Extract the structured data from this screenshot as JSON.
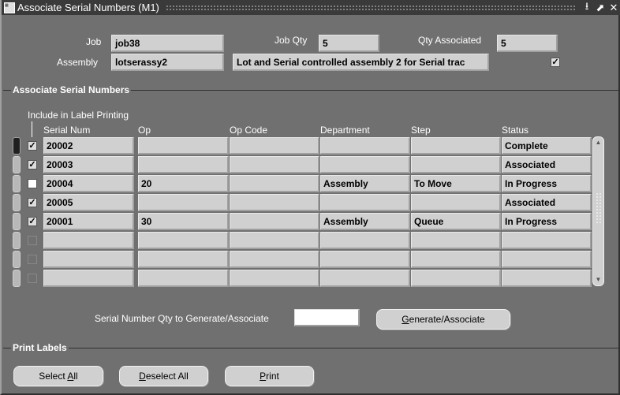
{
  "window": {
    "title": "Associate Serial Numbers (M1)",
    "controls": [
      "minimize",
      "maximize",
      "close"
    ]
  },
  "header": {
    "job_label": "Job",
    "job_value": "job38",
    "job_qty_label": "Job Qty",
    "job_qty_value": "5",
    "qty_associated_label": "Qty Associated",
    "qty_associated_value": "5",
    "assembly_label": "Assembly",
    "assembly_value": "lotserassy2",
    "assembly_description": "Lot and Serial controlled assembly 2 for Serial trac",
    "assembly_checkbox_checked": true
  },
  "associate_section": {
    "title": "Associate Serial Numbers",
    "include_label": "Include in Label Printing",
    "columns": [
      "Serial Num",
      "Op",
      "Op Code",
      "Department",
      "Step",
      "Status"
    ],
    "rows": [
      {
        "include": true,
        "serial": "20002",
        "op": "",
        "op_code": "",
        "department": "",
        "step": "",
        "status": "Complete"
      },
      {
        "include": true,
        "serial": "20003",
        "op": "",
        "op_code": "",
        "department": "",
        "step": "",
        "status": "Associated"
      },
      {
        "include": false,
        "serial": "20004",
        "op": "20",
        "op_code": "",
        "department": "Assembly",
        "step": "To Move",
        "status": "In Progress"
      },
      {
        "include": true,
        "serial": "20005",
        "op": "",
        "op_code": "",
        "department": "",
        "step": "",
        "status": "Associated"
      },
      {
        "include": true,
        "serial": "20001",
        "op": "30",
        "op_code": "",
        "department": "Assembly",
        "step": "Queue",
        "status": "In Progress"
      },
      {
        "include": false,
        "serial": "",
        "op": "",
        "op_code": "",
        "department": "",
        "step": "",
        "status": ""
      },
      {
        "include": false,
        "serial": "",
        "op": "",
        "op_code": "",
        "department": "",
        "step": "",
        "status": ""
      },
      {
        "include": false,
        "serial": "",
        "op": "",
        "op_code": "",
        "department": "",
        "step": "",
        "status": ""
      }
    ],
    "qty_label": "Serial Number Qty to Generate/Associate",
    "qty_value": "",
    "generate_button": {
      "mnemonic": "G",
      "rest": "enerate/Associate"
    }
  },
  "print_section": {
    "title": "Print Labels",
    "select_all": {
      "pre": "Select ",
      "mnemonic": "A",
      "rest": "ll"
    },
    "deselect_all": {
      "pre": "",
      "mnemonic": "D",
      "rest": "eselect All"
    },
    "print": {
      "pre": "",
      "mnemonic": "P",
      "rest": "rint"
    }
  }
}
